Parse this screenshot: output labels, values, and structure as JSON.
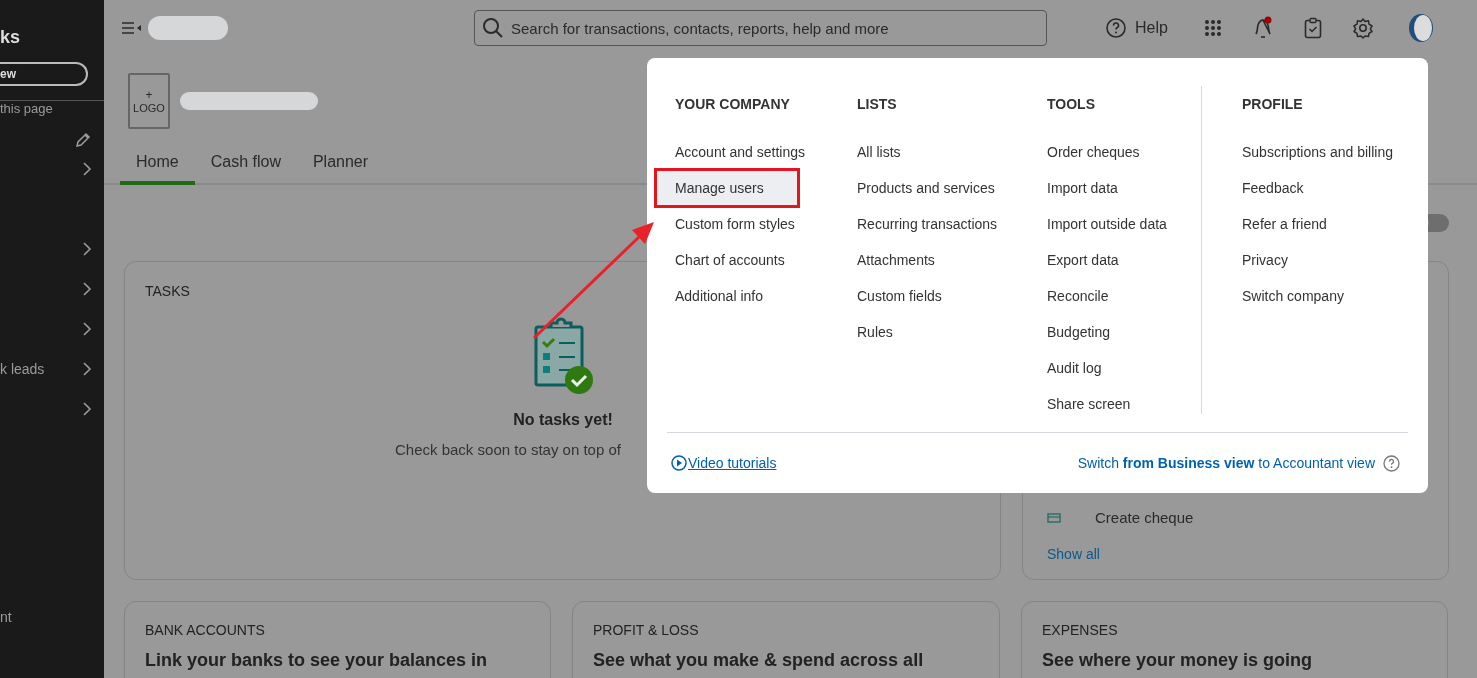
{
  "sidebar": {
    "title": "ks",
    "new_button": "ew",
    "link": "this page",
    "leads_item": "k leads",
    "footer_item": "nt"
  },
  "topbar": {
    "search": {
      "placeholder": "Search for transactions, contacts, reports, help and more"
    },
    "help": "Help",
    "notification_badge": true
  },
  "company": {
    "logo_plus": "+",
    "logo_label": "LOGO"
  },
  "view_toggle": {
    "on": false
  },
  "tabs": [
    {
      "label": "Home",
      "selected": true
    },
    {
      "label": "Cash flow",
      "selected": false
    },
    {
      "label": "Planner",
      "selected": false
    }
  ],
  "tasks_card": {
    "title": "TASKS",
    "empty_title": "No tasks yet!",
    "empty_text": "Check back soon to stay on top of"
  },
  "shortcuts_card": {
    "items": [
      "Create cheque"
    ],
    "show_all": "Show all"
  },
  "cards": [
    {
      "title": "BANK ACCOUNTS",
      "headline": "Link your banks to see your balances in"
    },
    {
      "title": "PROFIT & LOSS",
      "headline": "See what you make & spend across all"
    },
    {
      "title": "EXPENSES",
      "headline": "See where your money is going"
    }
  ],
  "settings_menu": {
    "columns": [
      {
        "heading": "YOUR COMPANY",
        "items": [
          {
            "label": "Account and settings",
            "selected": false,
            "marked": false
          },
          {
            "label": "Manage users",
            "selected": true,
            "marked": true
          },
          {
            "label": "Custom form styles",
            "selected": false,
            "marked": false
          },
          {
            "label": "Chart of accounts",
            "selected": false,
            "marked": false
          },
          {
            "label": "Additional info",
            "selected": false,
            "marked": false
          }
        ]
      },
      {
        "heading": "LISTS",
        "items": [
          {
            "label": "All lists",
            "selected": false,
            "marked": false
          },
          {
            "label": "Products and services",
            "selected": false,
            "marked": false
          },
          {
            "label": "Recurring transactions",
            "selected": false,
            "marked": false
          },
          {
            "label": "Attachments",
            "selected": false,
            "marked": false
          },
          {
            "label": "Custom fields",
            "selected": false,
            "marked": false
          },
          {
            "label": "Rules",
            "selected": false,
            "marked": false
          }
        ]
      },
      {
        "heading": "TOOLS",
        "items": [
          {
            "label": "Order cheques",
            "selected": false,
            "marked": false
          },
          {
            "label": "Import data",
            "selected": false,
            "marked": false
          },
          {
            "label": "Import outside data",
            "selected": false,
            "marked": false
          },
          {
            "label": "Export data",
            "selected": false,
            "marked": false
          },
          {
            "label": "Reconcile",
            "selected": false,
            "marked": false
          },
          {
            "label": "Budgeting",
            "selected": false,
            "marked": false
          },
          {
            "label": "Audit log",
            "selected": false,
            "marked": false
          },
          {
            "label": "Share screen",
            "selected": false,
            "marked": false
          }
        ]
      },
      {
        "heading": "PROFILE",
        "items": [
          {
            "label": "Subscriptions and billing",
            "selected": false,
            "marked": false
          },
          {
            "label": "Feedback",
            "selected": false,
            "marked": false
          },
          {
            "label": "Refer a friend",
            "selected": false,
            "marked": false
          },
          {
            "label": "Privacy",
            "selected": false,
            "marked": false
          },
          {
            "label": "Switch company",
            "selected": false,
            "marked": false
          }
        ]
      }
    ],
    "video_link": "Video tutorials",
    "switch_text": "Switch **from Business view** to Accountant view"
  }
}
